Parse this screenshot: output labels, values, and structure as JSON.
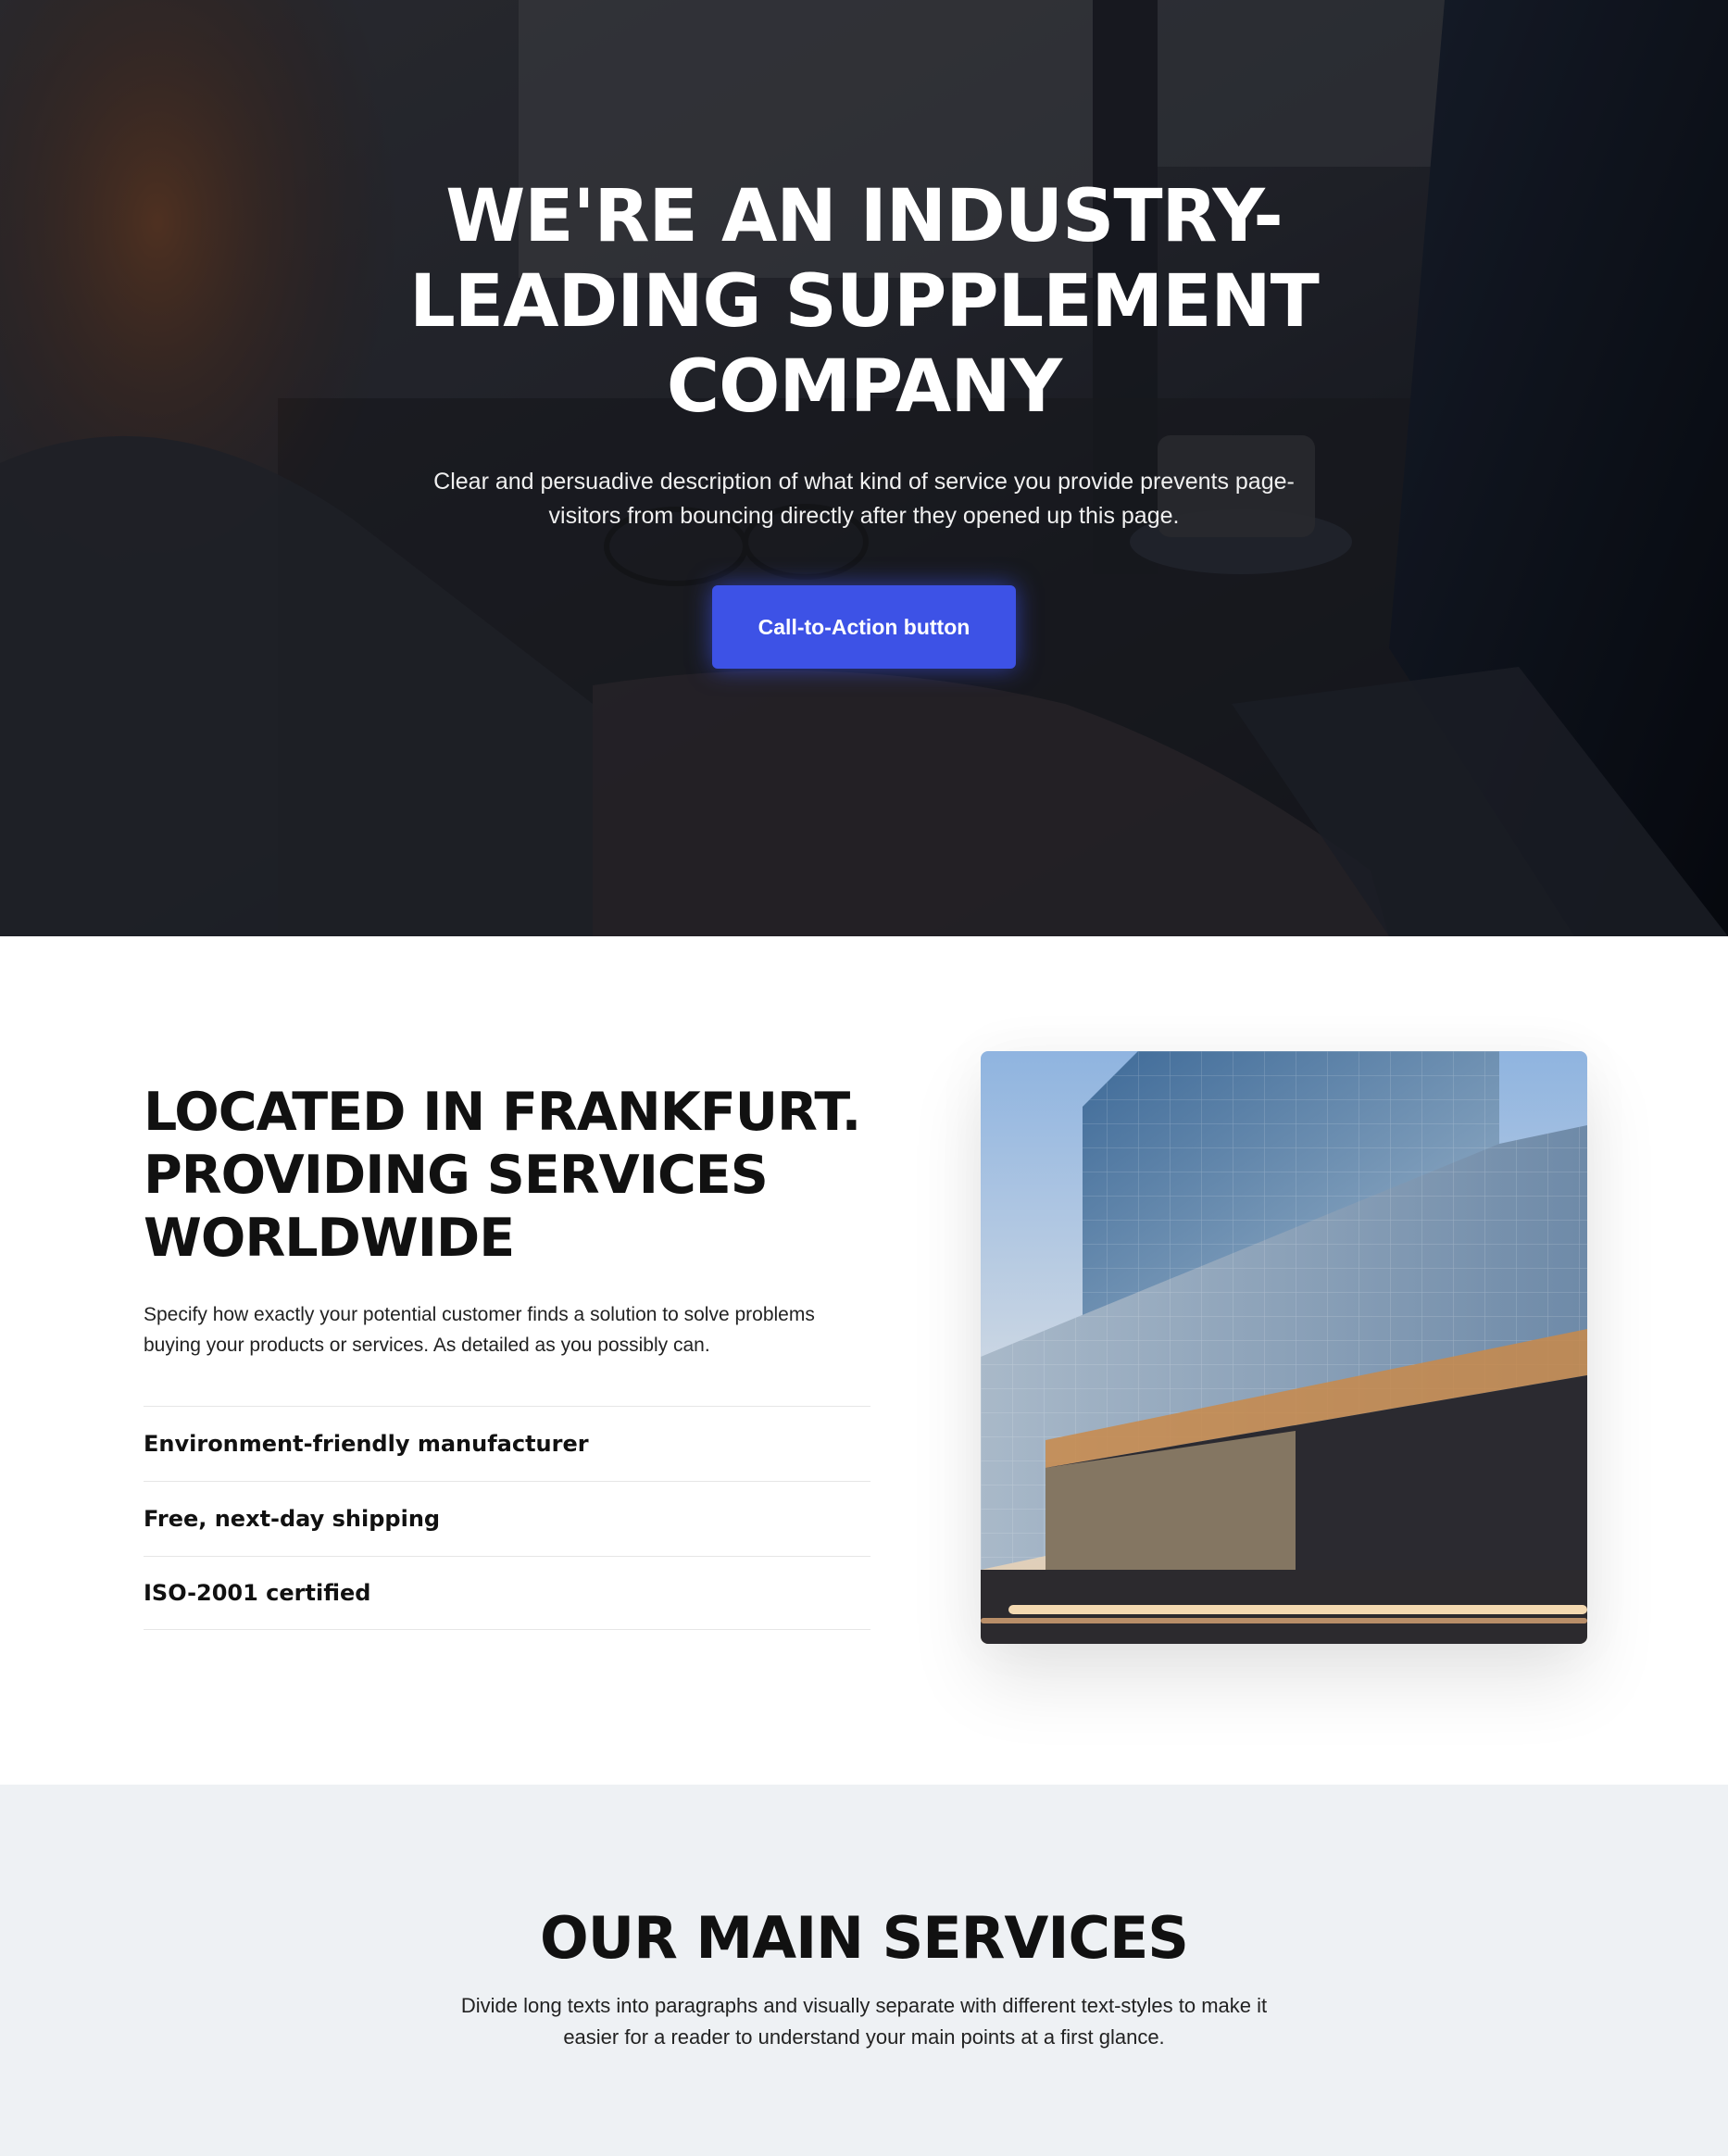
{
  "hero": {
    "title": "WE'RE AN INDUSTRY-LEADING SUPPLEMENT COMPANY",
    "description": "Clear and persuadive description of what kind of service you provide prevents page-visitors from bouncing directly after they opened up this page.",
    "cta_label": "Call-to-Action button",
    "background_image": "woman-typing-on-laptop-photo",
    "cta_color": "#3d52e6"
  },
  "location": {
    "title": "LOCATED IN FRANKFURT. PROVIDING SERVICES WORLDWIDE",
    "description": "Specify how exactly your potential customer finds a solution to solve problems buying your products or services. As detailed as you possibly can.",
    "features": [
      {
        "label": "Environment-friendly manufacturer"
      },
      {
        "label": "Free, next-day shipping"
      },
      {
        "label": "ISO-2001 certified"
      }
    ],
    "image": "glass-office-building-photo"
  },
  "services": {
    "title": "OUR MAIN SERVICES",
    "description": "Divide long texts into paragraphs and visually separate with different text-styles to make it easier for a reader to understand your main points at a first glance.",
    "background_color": "#eef1f4"
  }
}
